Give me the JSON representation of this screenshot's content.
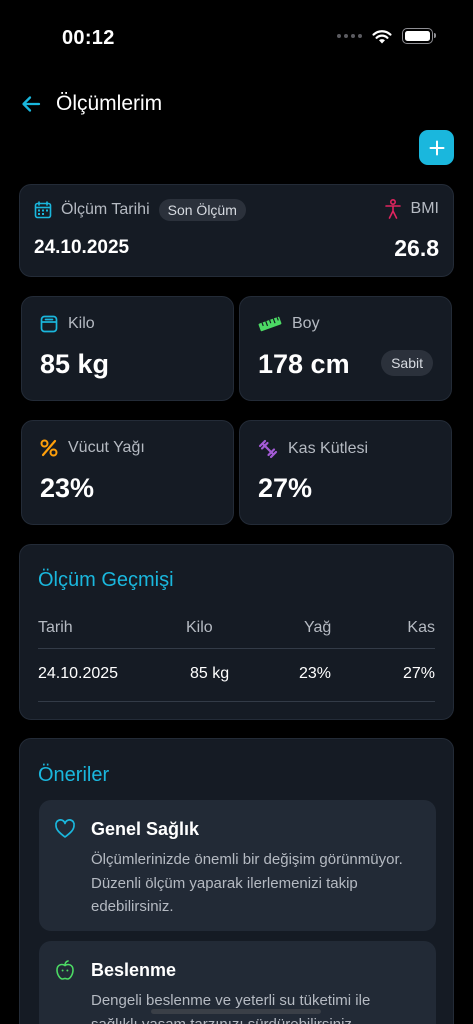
{
  "status_bar": {
    "time": "00:12"
  },
  "nav": {
    "title": "Ölçümlerim"
  },
  "summary": {
    "date_label": "Ölçüm Tarihi",
    "latest_badge": "Son Ölçüm",
    "date_value": "24.10.2025",
    "bmi_label": "BMI",
    "bmi_value": "26.8"
  },
  "stats": {
    "weight": {
      "label": "Kilo",
      "value": "85 kg"
    },
    "height": {
      "label": "Boy",
      "value": "178 cm",
      "badge": "Sabit"
    },
    "body_fat": {
      "label": "Vücut Yağı",
      "value": "23%"
    },
    "muscle": {
      "label": "Kas Kütlesi",
      "value": "27%"
    }
  },
  "history": {
    "title": "Ölçüm Geçmişi",
    "columns": [
      "Tarih",
      "Kilo",
      "Yağ",
      "Kas"
    ],
    "rows": [
      [
        "24.10.2025",
        "85 kg",
        "23%",
        "27%"
      ]
    ]
  },
  "recommendations": {
    "title": "Öneriler",
    "items": [
      {
        "title": "Genel Sağlık",
        "text": "Ölçümlerinizde önemli bir değişim görünmüyor. Düzenli ölçüm yaparak ilerlemenizi takip edebilirsiniz.",
        "icon": "heart-outline-icon"
      },
      {
        "title": "Beslenme",
        "text": "Dengeli beslenme ve yeterli su tüketimi ile sağlıklı yaşam tarzınızı sürdürebilirsiniz.",
        "icon": "apple-icon"
      }
    ]
  },
  "colors": {
    "accent": "#1ab7dd",
    "background": "#000000",
    "card": "#151b24",
    "weight_icon": "#1ab7dd",
    "height_icon": "#4cd964",
    "fat_icon": "#ff9f0a",
    "muscle_icon": "#a45bd6",
    "bmi_icon": "#e0245e",
    "apple_icon": "#4cd964"
  }
}
